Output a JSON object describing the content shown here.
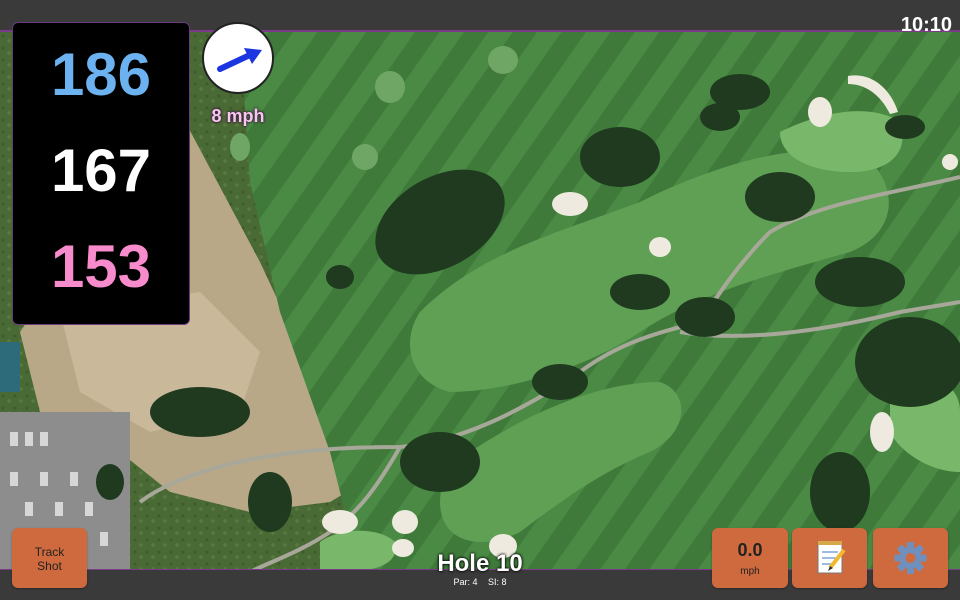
{
  "status_bar": {
    "time": "10:10"
  },
  "distances": {
    "back": "186",
    "middle": "167",
    "front": "153"
  },
  "wind": {
    "speed_label": "8 mph",
    "direction_icon": "wind-arrow-icon"
  },
  "hole": {
    "title": "Hole 10",
    "par_label": "Par: 4",
    "stroke_index_label": "SI: 8"
  },
  "buttons": {
    "track_shot_line1": "Track",
    "track_shot_line2": "Shot",
    "speed_value": "0.0",
    "speed_unit": "mph",
    "notes_icon": "notepad-icon",
    "settings_icon": "gear-icon"
  },
  "colors": {
    "back_distance": "#6cb2f0",
    "middle_distance": "#ffffff",
    "front_distance": "#f78bcb",
    "button": "#cf6a3e",
    "wind_arrow": "#1b35e0"
  }
}
